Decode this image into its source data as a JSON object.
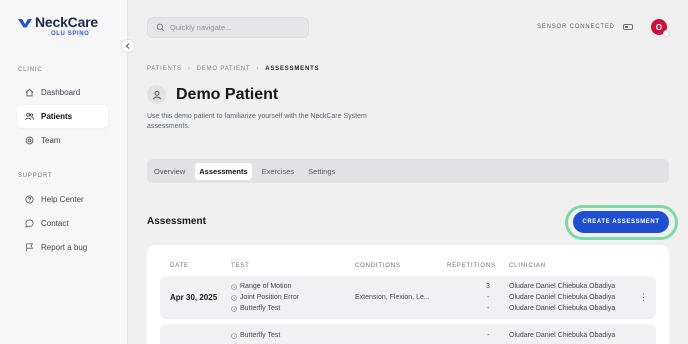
{
  "app": {
    "brand": "NeckCare",
    "product": "OLU SPINO"
  },
  "sidebar": {
    "sections": [
      {
        "label": "CLINIC"
      },
      {
        "label": "SUPPORT"
      }
    ],
    "clinic_items": [
      {
        "label": "Dashboard",
        "icon": "home-icon"
      },
      {
        "label": "Patients",
        "icon": "users-icon",
        "active": true
      },
      {
        "label": "Team",
        "icon": "team-icon"
      }
    ],
    "support_items": [
      {
        "label": "Help Center",
        "icon": "help-icon"
      },
      {
        "label": "Contact",
        "icon": "chat-icon"
      },
      {
        "label": "Report a bug",
        "icon": "flag-icon"
      }
    ]
  },
  "header": {
    "search_placeholder": "Quickly navigate...",
    "sensor_status": "SENSOR CONNECTED",
    "avatar_initial": "O"
  },
  "breadcrumb": [
    "PATIENTS",
    "DEMO PATIENT",
    "ASSESSMENTS"
  ],
  "patient": {
    "name": "Demo Patient",
    "description": "Use this demo patient to familiarize yourself with the NeckCare System assessments."
  },
  "tabs": [
    {
      "label": "Overview"
    },
    {
      "label": "Assessments",
      "active": true
    },
    {
      "label": "Exercises"
    },
    {
      "label": "Settings"
    }
  ],
  "assessment": {
    "title": "Assessment",
    "create_label": "CREATE ASSESSMENT",
    "columns": [
      "DATE",
      "TEST",
      "CONDITIONS",
      "REPETITIONS",
      "CLINICIAN"
    ],
    "rows": [
      {
        "date": "Apr 30, 2025",
        "tests": [
          "Range of Motion",
          "Joint Position Error",
          "Butterfly Test"
        ],
        "conditions": "Extension, Flexion, Le...",
        "repetitions": [
          "3",
          "-",
          "-"
        ],
        "clinicians": [
          "Oludare Daniel Chiebuka Obadiya",
          "Oludare Daniel Chiebuka Obadiya",
          "Oludare Daniel Chiebuka Obadiya"
        ]
      },
      {
        "date": "",
        "tests": [
          "Butterfly Test"
        ],
        "conditions": "",
        "repetitions": [
          "-"
        ],
        "clinicians": [
          "Oludare Daniel Chiebuka Obadiya"
        ]
      }
    ]
  },
  "colors": {
    "accent": "#1f4fd1",
    "highlight_ring": "#7ed8a8",
    "avatar": "#c8133a"
  }
}
